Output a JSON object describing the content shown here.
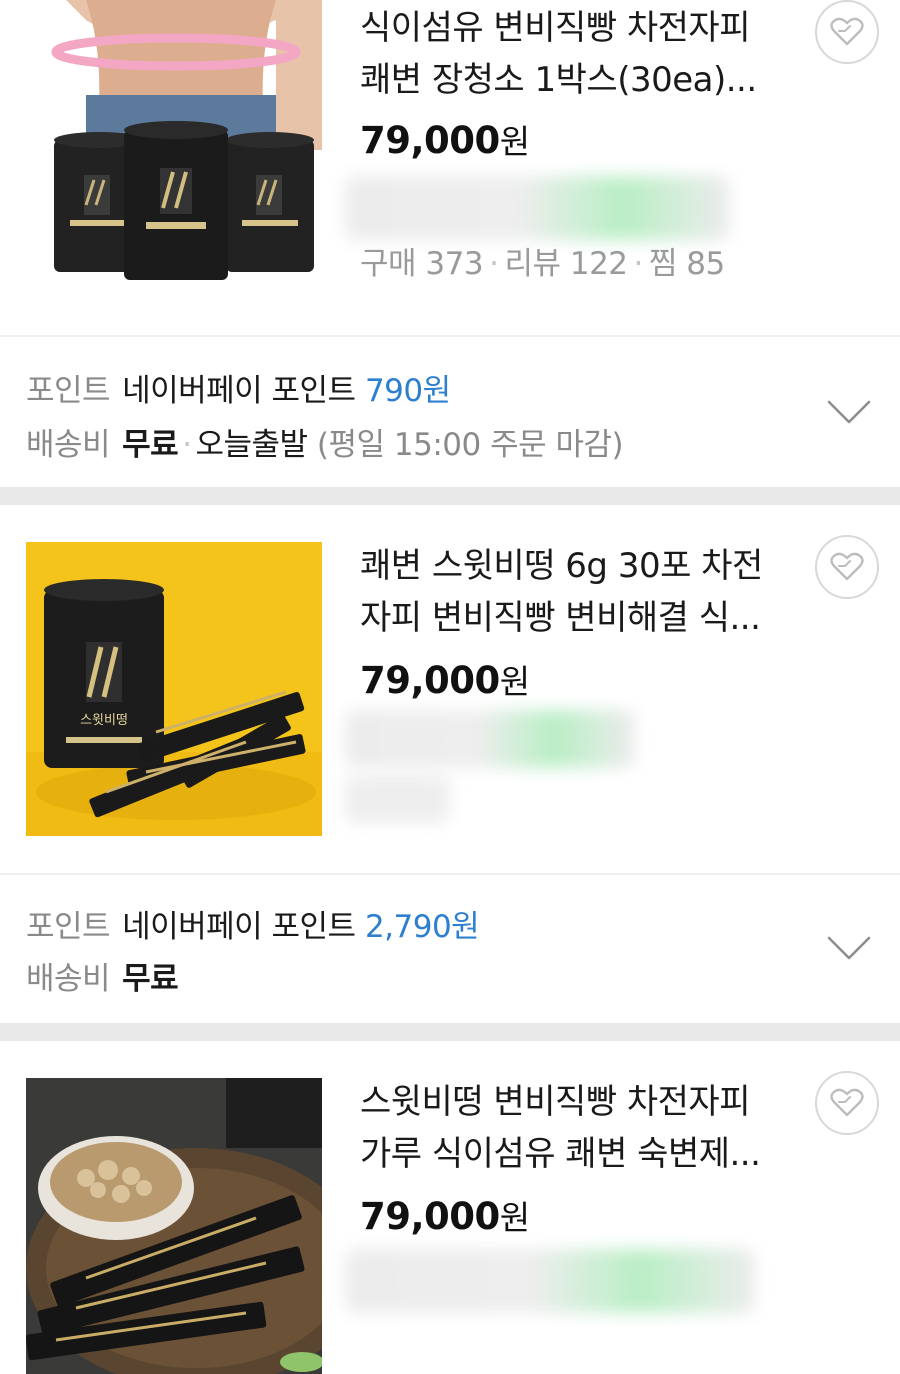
{
  "products": [
    {
      "title_lines": [
        "식이섬유 변비직빵 차전자피",
        "쾌변 장청소 1박스(30ea)..."
      ],
      "price": "79,000",
      "currency": "원",
      "stats": {
        "purchase_label": "구매",
        "purchase_count": "373",
        "review_label": "리뷰",
        "review_count": "122",
        "wish_label": "찜",
        "wish_count": "85"
      },
      "point_label": "포인트",
      "point_text": "네이버페이 포인트",
      "point_value": "790원",
      "shipping_label": "배송비",
      "shipping_value": "무료",
      "dispatch": "오늘출발",
      "dispatch_note": "(평일 15:00 주문 마감)"
    },
    {
      "title_lines": [
        "쾌변 스윗비떵 6g 30포 차전",
        "자피 변비직빵 변비해결 식..."
      ],
      "price": "79,000",
      "currency": "원",
      "point_label": "포인트",
      "point_text": "네이버페이 포인트",
      "point_value": "2,790원",
      "shipping_label": "배송비",
      "shipping_value": "무료"
    },
    {
      "title_lines": [
        "스윗비떵 변비직빵 차전자피",
        "가루 식이섬유 쾌변 숙변제..."
      ],
      "price": "79,000",
      "currency": "원"
    }
  ],
  "package_label": "스윗비떵",
  "icons": {
    "wishlist": "heart-icon",
    "expand": "chevron-down-icon"
  },
  "colors": {
    "point_blue": "#2f7fd0",
    "muted_gray": "#8a8a8a",
    "separator": "#e9e9e9"
  }
}
